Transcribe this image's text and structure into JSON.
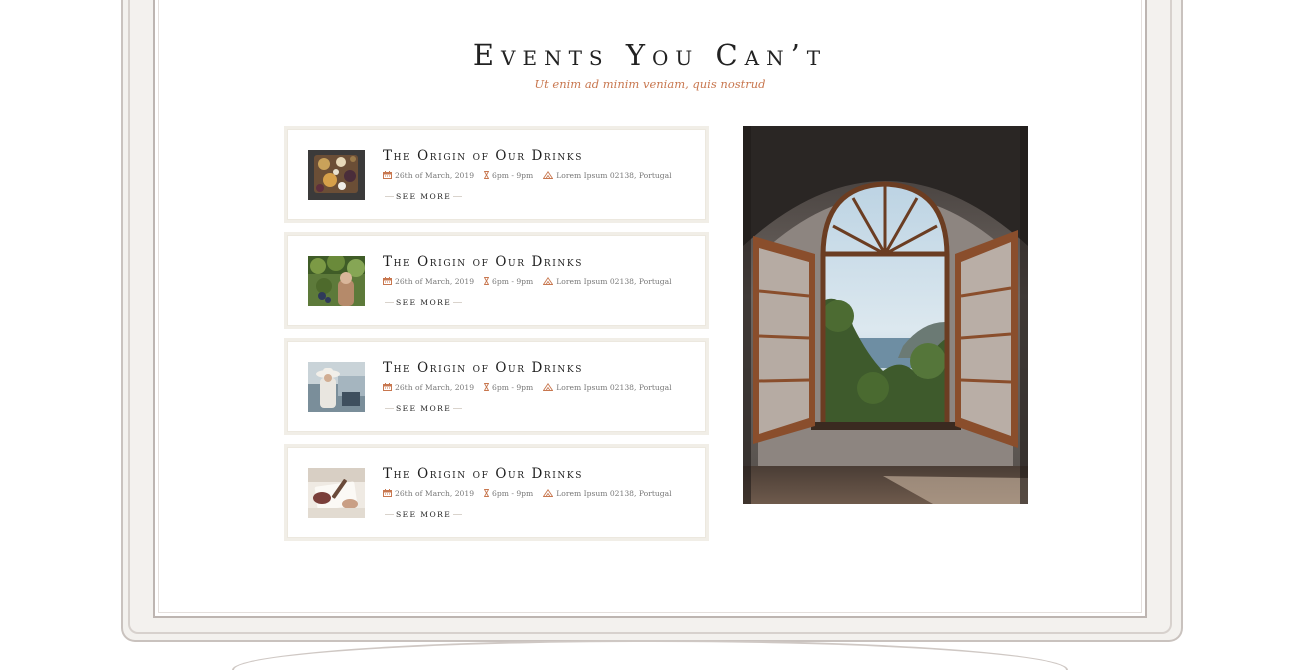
{
  "page": {
    "title": "Events You Can’t",
    "subtitle": "Ut enim ad minim veniam, quis nostrud"
  },
  "events": [
    {
      "title": "The Origin of Our Drinks",
      "date": "26th of March, 2019",
      "time": "6pm - 9pm",
      "location": "Lorem Ipsum 02138, Portugal",
      "link": "see more",
      "thumb": "food-platter"
    },
    {
      "title": "The Origin of Our Drinks",
      "date": "26th of March, 2019",
      "time": "6pm - 9pm",
      "location": "Lorem Ipsum 02138, Portugal",
      "link": "see more",
      "thumb": "vineyard"
    },
    {
      "title": "The Origin of Our Drinks",
      "date": "26th of March, 2019",
      "time": "6pm - 9pm",
      "location": "Lorem Ipsum 02138, Portugal",
      "link": "see more",
      "thumb": "woman-hat-coast"
    },
    {
      "title": "The Origin of Our Drinks",
      "date": "26th of March, 2019",
      "time": "6pm - 9pm",
      "location": "Lorem Ipsum 02138, Portugal",
      "link": "see more",
      "thumb": "hands-writing"
    }
  ],
  "icons": {
    "date": "calendar-icon",
    "time": "hourglass-icon",
    "location": "mountain-icon"
  },
  "colors": {
    "accent": "#c8774f",
    "title": "#222222",
    "border": "#f1eee7"
  },
  "feature_image": "arched-window-sea-view"
}
